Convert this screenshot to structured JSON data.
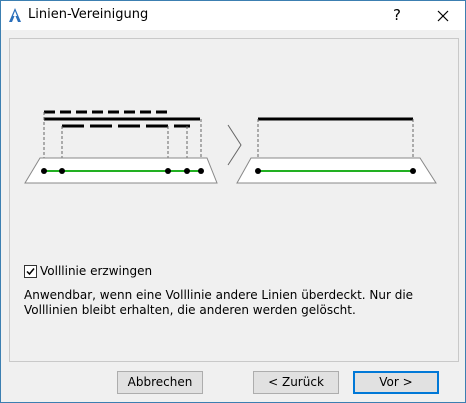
{
  "window": {
    "title": "Linien-Vereinigung",
    "help_label": "?",
    "close_label": "✕"
  },
  "option": {
    "label": "Volllinie erzwingen",
    "checked": true
  },
  "description": "Anwendbar, wenn eine Volllinie andere Linien überdeckt. Nur die Volllinien bleibt erhalten, die anderen werden gelöscht.",
  "buttons": {
    "cancel": "Abbrechen",
    "back": "< Zurück",
    "next": "Vor >"
  },
  "colors": {
    "accent": "#0078d7",
    "result_line": "#22b022",
    "icon_blue": "#2a6fbb"
  }
}
